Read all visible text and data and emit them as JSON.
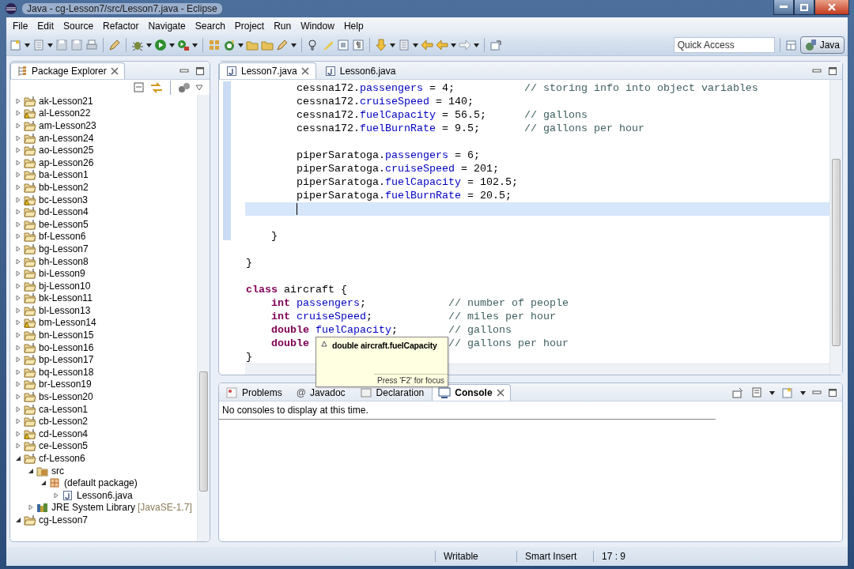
{
  "window": {
    "title": "Java - cg-Lesson7/src/Lesson7.java - Eclipse"
  },
  "menu": [
    "File",
    "Edit",
    "Source",
    "Refactor",
    "Navigate",
    "Search",
    "Project",
    "Run",
    "Window",
    "Help"
  ],
  "quick_access": {
    "placeholder": "Quick Access"
  },
  "perspective": {
    "label": "Java",
    "selected": true
  },
  "package_explorer": {
    "title": "Package Explorer",
    "tree": [
      {
        "label": "ak-Lesson21",
        "kind": "project",
        "expanded": false,
        "warning": false
      },
      {
        "label": "al-Lesson22",
        "kind": "project",
        "expanded": false,
        "warning": true
      },
      {
        "label": "am-Lesson23",
        "kind": "project",
        "expanded": false,
        "warning": false
      },
      {
        "label": "an-Lesson24",
        "kind": "project",
        "expanded": false,
        "warning": false
      },
      {
        "label": "ao-Lesson25",
        "kind": "project",
        "expanded": false,
        "warning": false
      },
      {
        "label": "ap-Lesson26",
        "kind": "project",
        "expanded": false,
        "warning": false
      },
      {
        "label": "ba-Lesson1",
        "kind": "project",
        "expanded": false,
        "warning": false
      },
      {
        "label": "bb-Lesson2",
        "kind": "project",
        "expanded": false,
        "warning": false
      },
      {
        "label": "bc-Lesson3",
        "kind": "project",
        "expanded": false,
        "warning": true
      },
      {
        "label": "bd-Lesson4",
        "kind": "project",
        "expanded": false,
        "warning": false
      },
      {
        "label": "be-Lesson5",
        "kind": "project",
        "expanded": false,
        "warning": false
      },
      {
        "label": "bf-Lesson6",
        "kind": "project",
        "expanded": false,
        "warning": false
      },
      {
        "label": "bg-Lesson7",
        "kind": "project",
        "expanded": false,
        "warning": false
      },
      {
        "label": "bh-Lesson8",
        "kind": "project",
        "expanded": false,
        "warning": false
      },
      {
        "label": "bi-Lesson9",
        "kind": "project",
        "expanded": false,
        "warning": false
      },
      {
        "label": "bj-Lesson10",
        "kind": "project",
        "expanded": false,
        "warning": false
      },
      {
        "label": "bk-Lesson11",
        "kind": "project",
        "expanded": false,
        "warning": false
      },
      {
        "label": "bl-Lesson13",
        "kind": "project",
        "expanded": false,
        "warning": false
      },
      {
        "label": "bm-Lesson14",
        "kind": "project",
        "expanded": false,
        "warning": true
      },
      {
        "label": "bn-Lesson15",
        "kind": "project",
        "expanded": false,
        "warning": false
      },
      {
        "label": "bo-Lesson16",
        "kind": "project",
        "expanded": false,
        "warning": false
      },
      {
        "label": "bp-Lesson17",
        "kind": "project",
        "expanded": false,
        "warning": false
      },
      {
        "label": "bq-Lesson18",
        "kind": "project",
        "expanded": false,
        "warning": false
      },
      {
        "label": "br-Lesson19",
        "kind": "project",
        "expanded": false,
        "warning": false
      },
      {
        "label": "bs-Lesson20",
        "kind": "project",
        "expanded": false,
        "warning": false
      },
      {
        "label": "ca-Lesson1",
        "kind": "project",
        "expanded": false,
        "warning": false
      },
      {
        "label": "cb-Lesson2",
        "kind": "project",
        "expanded": false,
        "warning": false
      },
      {
        "label": "cd-Lesson4",
        "kind": "project",
        "expanded": false,
        "warning": true
      },
      {
        "label": "ce-Lesson5",
        "kind": "project",
        "expanded": false,
        "warning": false
      },
      {
        "label": "cf-Lesson6",
        "kind": "project",
        "expanded": true,
        "warning": false,
        "children": [
          {
            "label": "src",
            "kind": "source",
            "expanded": true,
            "children": [
              {
                "label": "(default package)",
                "kind": "package",
                "expanded": true,
                "children": [
                  {
                    "label": "Lesson6.java",
                    "kind": "file",
                    "expanded": false
                  }
                ]
              }
            ]
          },
          {
            "label": "JRE System Library",
            "detail": "[JavaSE-1.7]",
            "kind": "library",
            "expanded": false
          }
        ]
      },
      {
        "label": "cg-Lesson7",
        "kind": "project",
        "expanded": true,
        "warning": false
      }
    ]
  },
  "editor": {
    "tabs": [
      {
        "label": "Lesson7.java",
        "selected": true
      },
      {
        "label": "Lesson6.java",
        "selected": false
      }
    ],
    "lines": [
      {
        "current": false,
        "segments": [
          {
            "kind": "plain",
            "text": "        cessna172."
          },
          {
            "kind": "field",
            "text": "passengers"
          },
          {
            "kind": "plain",
            "text": " = 4;"
          },
          {
            "kind": "comment",
            "text": "           // storing info into object variables"
          }
        ]
      },
      {
        "current": false,
        "segments": [
          {
            "kind": "plain",
            "text": "        cessna172."
          },
          {
            "kind": "field",
            "text": "cruiseSpeed"
          },
          {
            "kind": "plain",
            "text": " = 140;"
          }
        ]
      },
      {
        "current": false,
        "segments": [
          {
            "kind": "plain",
            "text": "        cessna172."
          },
          {
            "kind": "field",
            "text": "fuelCapacity"
          },
          {
            "kind": "plain",
            "text": " = 56.5;"
          },
          {
            "kind": "comment",
            "text": "      // gallons"
          }
        ]
      },
      {
        "current": false,
        "segments": [
          {
            "kind": "plain",
            "text": "        cessna172."
          },
          {
            "kind": "field",
            "text": "fuelBurnRate"
          },
          {
            "kind": "plain",
            "text": " = 9.5;"
          },
          {
            "kind": "comment",
            "text": "       // gallons per hour"
          }
        ]
      },
      {
        "current": false
      },
      {
        "current": false,
        "segments": [
          {
            "kind": "plain",
            "text": "        piperSaratoga."
          },
          {
            "kind": "field",
            "text": "passengers"
          },
          {
            "kind": "plain",
            "text": " = 6;"
          }
        ]
      },
      {
        "current": false,
        "segments": [
          {
            "kind": "plain",
            "text": "        piperSaratoga."
          },
          {
            "kind": "field",
            "text": "cruiseSpeed"
          },
          {
            "kind": "plain",
            "text": " = 201;"
          }
        ]
      },
      {
        "current": false,
        "segments": [
          {
            "kind": "plain",
            "text": "        piperSaratoga."
          },
          {
            "kind": "field",
            "text": "fuelCapacity"
          },
          {
            "kind": "plain",
            "text": " = 102.5;"
          }
        ]
      },
      {
        "current": false,
        "segments": [
          {
            "kind": "plain",
            "text": "        piperSaratoga."
          },
          {
            "kind": "field",
            "text": "fuelBurnRate"
          },
          {
            "kind": "plain",
            "text": " = 20.5;"
          }
        ]
      },
      {
        "current": true
      },
      {
        "current": false
      },
      {
        "current": false,
        "segments": [
          {
            "kind": "plain",
            "text": "    }"
          }
        ]
      },
      {
        "current": false
      },
      {
        "current": false,
        "segments": [
          {
            "kind": "plain",
            "text": "}"
          }
        ]
      },
      {
        "current": false
      },
      {
        "current": false,
        "segments": [
          {
            "kind": "keyword",
            "text": "class"
          },
          {
            "kind": "plain",
            "text": " aircraft {"
          }
        ]
      },
      {
        "current": false,
        "segments": [
          {
            "kind": "keyword",
            "text": "    int"
          },
          {
            "kind": "field",
            "text": " passengers"
          },
          {
            "kind": "plain",
            "text": ";"
          },
          {
            "kind": "comment",
            "text": "             // number of people"
          }
        ]
      },
      {
        "current": false,
        "segments": [
          {
            "kind": "keyword",
            "text": "    int"
          },
          {
            "kind": "field",
            "text": " cruiseSpeed"
          },
          {
            "kind": "plain",
            "text": ";"
          },
          {
            "kind": "comment",
            "text": "            // miles per hour"
          }
        ]
      },
      {
        "current": false,
        "segments": [
          {
            "kind": "keyword",
            "text": "    double"
          },
          {
            "kind": "field",
            "text": " fuelCapacity"
          },
          {
            "kind": "plain",
            "text": ";"
          },
          {
            "kind": "comment",
            "text": "        // gallons"
          }
        ]
      },
      {
        "current": false,
        "segments": [
          {
            "kind": "keyword",
            "text": "    double"
          },
          {
            "kind": "comment",
            "text": "                      // gallons per hour"
          }
        ]
      },
      {
        "current": false,
        "segments": [
          {
            "kind": "plain",
            "text": "}"
          }
        ]
      }
    ],
    "hover": {
      "signature": "double aircraft.fuelCapacity",
      "footer": "Press 'F2' for focus"
    }
  },
  "bottom_panel": {
    "tabs": [
      {
        "label": "Problems",
        "selected": false
      },
      {
        "label": "Javadoc",
        "icon": "@",
        "selected": false
      },
      {
        "label": "Declaration",
        "selected": false
      },
      {
        "label": "Console",
        "selected": true
      }
    ],
    "message": "No consoles to display at this time."
  },
  "status_bar": [
    "Writable",
    "Smart Insert",
    "17 : 9"
  ]
}
